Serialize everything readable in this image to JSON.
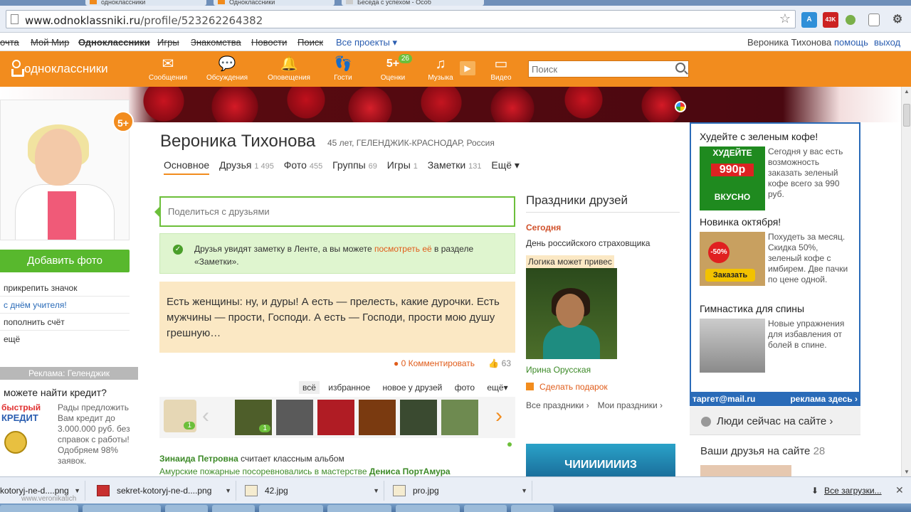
{
  "browser": {
    "url_host": "www.odnoklassniki.ru",
    "url_path": "/profile/523262264382",
    "tabs": [
      "одноклассники",
      "Одноклассники",
      "Беседа с успехом - Особ"
    ],
    "ext_badge": "43K"
  },
  "portal": {
    "links": [
      "очта",
      "Мой Мир",
      "Одноклассники",
      "Игры",
      "Знакомства",
      "Новости",
      "Поиск"
    ],
    "all_projects": "Все проекты",
    "user": "Вероника Тихонова",
    "help": "помощь",
    "logout": "выход"
  },
  "header": {
    "logo": "одноклассники",
    "nav": [
      {
        "label": "Сообщения",
        "icon": "envelope-icon",
        "glyph": "✉"
      },
      {
        "label": "Обсуждения",
        "icon": "chat-bubbles-icon",
        "glyph": "💬"
      },
      {
        "label": "Оповещения",
        "icon": "bell-icon",
        "glyph": "🔔"
      },
      {
        "label": "Гости",
        "icon": "footprints-icon",
        "glyph": "👣"
      },
      {
        "label": "Оценки",
        "icon": "five-plus-icon",
        "glyph": "5+",
        "badge": "26"
      },
      {
        "label": "Музыка",
        "icon": "music-note-icon",
        "glyph": "♫"
      },
      {
        "label": "Видео",
        "icon": "video-icon",
        "glyph": "▭"
      }
    ],
    "search_placeholder": "Поиск"
  },
  "left": {
    "rating_badge": "5+",
    "add_photo": "Добавить фото",
    "links": [
      "прикрепить значок",
      "с днём учителя!",
      "пополнить счёт",
      "ещё"
    ],
    "ad_header": "Реклама: Геленджик",
    "ad_question": "можете найти кредит?",
    "ad_logo_1": "быстрый",
    "ad_logo_2": "КРЕДИТ",
    "ad_text": "Рады предложить Вам кредит до 3.000.000 руб. без справок с работы! Одобряем 98% заявок."
  },
  "profile": {
    "name": "Вероника Тихонова",
    "info": "45 лет, ГЕЛЕНДЖИК-КРАСНОДАР, Россия",
    "tabs": [
      {
        "label": "Основное",
        "count": ""
      },
      {
        "label": "Друзья",
        "count": "1 495"
      },
      {
        "label": "Фото",
        "count": "455"
      },
      {
        "label": "Группы",
        "count": "69"
      },
      {
        "label": "Игры",
        "count": "1"
      },
      {
        "label": "Заметки",
        "count": "131"
      },
      {
        "label": "Ещё ▾",
        "count": ""
      }
    ],
    "share_placeholder": "Поделиться с друзьями",
    "notice_1": "Друзья увидят заметку в Ленте, а вы можете ",
    "notice_link": "посмотреть её",
    "notice_2": " в разделе «Заметки».",
    "quote": "Есть женщины: ну, и дуры! А есть — прелесть, какие дурочки. Есть мужчины — прости, Господи. А есть — Господи, прости мою душу грешную…",
    "comment": "0 Комментировать",
    "likes": "63",
    "filters": [
      "всё",
      "избранное",
      "новое у друзей",
      "фото",
      "ещё▾"
    ],
    "strip_count": "1",
    "feed_user": "Зинаида Петровна",
    "feed_action": " считает классным альбом",
    "feed_album": "Амурские пожарные посоревновались в мастерстве ",
    "feed_author": "Дениса ПортАмура"
  },
  "holidays": {
    "title": "Праздники друзей",
    "today": "Сегодня",
    "holiday": "День российского страховщика",
    "caption": "Логика может привес",
    "friend": "Ирина Орусская",
    "gift": "Сделать подарок",
    "all": "Все праздники ›",
    "mine": "Мои праздники ›",
    "game": "ЧИИИИИИИЗ"
  },
  "rightads": [
    {
      "title": "Худейте с зеленым кофе!",
      "img_1": "ХУДЕЙТЕ",
      "img_2": "990р",
      "img_3": "ВКУСНО",
      "text": "Сегодня у вас есть возможность заказать зеленый кофе всего за 990 руб."
    },
    {
      "title": "Новинка октября!",
      "img_1": "-50%",
      "img_2": "Заказать",
      "text": "Похудеть за месяц. Скидка 50%, зеленый кофе с имбирем. Две пачки по цене одной."
    },
    {
      "title": "Гимнастика для спины",
      "text": "Новые упражнения для избавления от болей в спине."
    }
  ],
  "adfoot": {
    "left": "таргет@mail.ru",
    "right": "реклама здесь ›"
  },
  "people_now": "Люди сейчас на сайте ›",
  "friends_now": {
    "label": "Ваши друзья на сайте",
    "count": "28"
  },
  "downloads": {
    "files": [
      "kotoryj-ne-d....png",
      "sekret-kotoryj-ne-d....png",
      "42.jpg",
      "pro.jpg"
    ],
    "all": "Все загрузки..."
  },
  "watermark": "www.veronikatich",
  "colors": {
    "ok_orange": "#f28c1e",
    "green": "#6cbf3a",
    "ad_blue": "#2a6bb8"
  }
}
